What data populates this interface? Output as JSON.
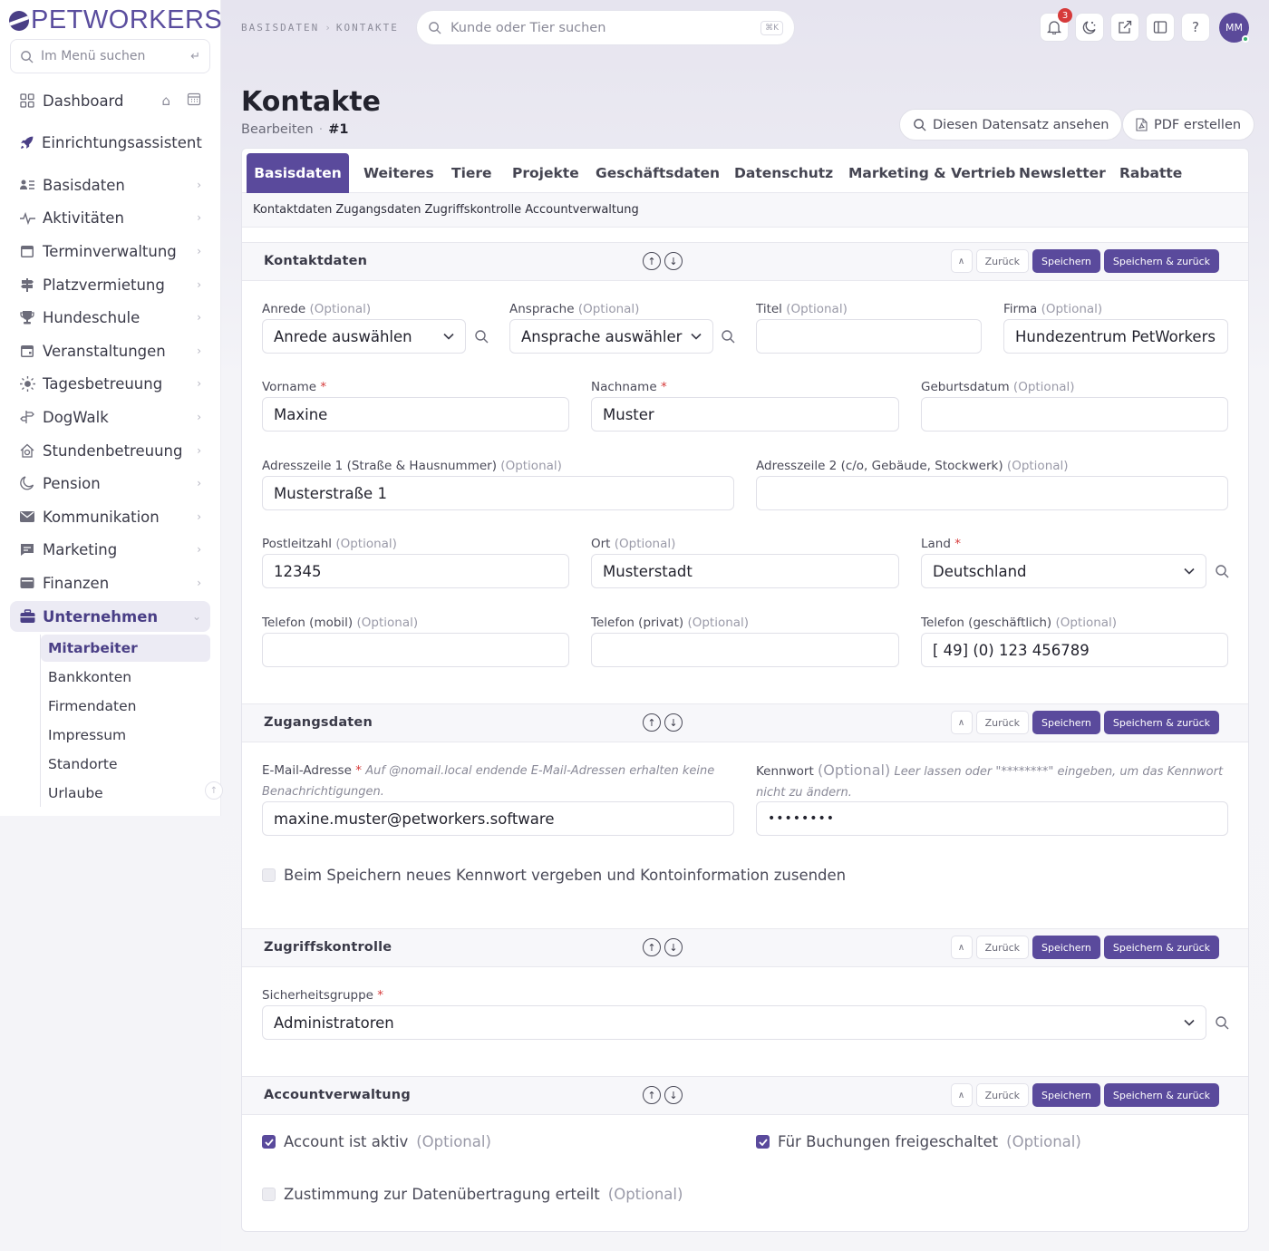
{
  "brand": {
    "name": "PETWORKERS"
  },
  "sidebar": {
    "search_placeholder": "Im Menü suchen",
    "items": [
      {
        "label": "Dashboard",
        "icon": "dashboard-grid-icon"
      },
      {
        "label": "Einrichtungsassistent",
        "icon": "rocket-icon"
      },
      {
        "label": "Basisdaten",
        "icon": "list-user-icon"
      },
      {
        "label": "Aktivitäten",
        "icon": "activity-icon"
      },
      {
        "label": "Terminverwaltung",
        "icon": "calendar-icon"
      },
      {
        "label": "Platzvermietung",
        "icon": "signpost-icon"
      },
      {
        "label": "Hundeschule",
        "icon": "trophy-icon"
      },
      {
        "label": "Veranstaltungen",
        "icon": "calendar-event-icon"
      },
      {
        "label": "Tagesbetreuung",
        "icon": "sun-icon"
      },
      {
        "label": "DogWalk",
        "icon": "signpost-split-icon"
      },
      {
        "label": "Stundenbetreuung",
        "icon": "house-clock-icon"
      },
      {
        "label": "Pension",
        "icon": "moon-icon"
      },
      {
        "label": "Kommunikation",
        "icon": "envelope-icon"
      },
      {
        "label": "Marketing",
        "icon": "chat-icon"
      },
      {
        "label": "Finanzen",
        "icon": "wallet-icon"
      },
      {
        "label": "Unternehmen",
        "icon": "briefcase-icon"
      }
    ],
    "sub_items": [
      "Mitarbeiter",
      "Bankkonten",
      "Firmendaten",
      "Impressum",
      "Standorte",
      "Urlaube"
    ]
  },
  "topbar": {
    "breadcrumb": [
      "BASISDATEN",
      "KONTAKTE"
    ],
    "search_placeholder": "Kunde oder Tier suchen",
    "search_shortcut": "⌘K",
    "notification_count": "3",
    "help": "?",
    "avatar_initials": "MM"
  },
  "page": {
    "title": "Kontakte",
    "mode": "Bearbeiten",
    "record": "#1",
    "view_button": "Diesen Datensatz ansehen",
    "pdf_button": "PDF erstellen"
  },
  "tabs": [
    "Basisdaten",
    "Weiteres",
    "Tiere",
    "Projekte",
    "Geschäftsdaten",
    "Datenschutz",
    "Marketing & Vertrieb",
    "Newsletter",
    "Rabatte"
  ],
  "subnav": [
    "Kontaktdaten",
    "Zugangsdaten",
    "Zugriffskontrolle",
    "Accountverwaltung"
  ],
  "actions": {
    "up": "∧",
    "back": "Zurück",
    "save": "Speichern",
    "save_back": "Speichern & zurück"
  },
  "labels": {
    "optional": "(Optional)",
    "required": "*"
  },
  "sections": {
    "kontaktdaten": {
      "title": "Kontaktdaten",
      "anrede": {
        "label": "Anrede",
        "value": "Anrede auswählen"
      },
      "ansprache": {
        "label": "Ansprache",
        "value": "Ansprache auswähler"
      },
      "titel": {
        "label": "Titel",
        "value": ""
      },
      "firma": {
        "label": "Firma",
        "value": "Hundezentrum PetWorkers"
      },
      "vorname": {
        "label": "Vorname",
        "value": "Maxine"
      },
      "nachname": {
        "label": "Nachname",
        "value": "Muster"
      },
      "geburtsdatum": {
        "label": "Geburtsdatum",
        "value": ""
      },
      "adresse1": {
        "label": "Adresszeile 1 (Straße & Hausnummer)",
        "value": "Musterstraße 1"
      },
      "adresse2": {
        "label": "Adresszeile 2 (c/o, Gebäude, Stockwerk)",
        "value": ""
      },
      "plz": {
        "label": "Postleitzahl",
        "value": "12345"
      },
      "ort": {
        "label": "Ort",
        "value": "Musterstadt"
      },
      "land": {
        "label": "Land",
        "value": "Deutschland"
      },
      "tel_mobil": {
        "label": "Telefon (mobil)",
        "value": ""
      },
      "tel_privat": {
        "label": "Telefon (privat)",
        "value": ""
      },
      "tel_geschaeftlich": {
        "label": "Telefon (geschäftlich)",
        "value": "[ 49] (0) 123 456789"
      }
    },
    "zugangsdaten": {
      "title": "Zugangsdaten",
      "email": {
        "label": "E-Mail-Adresse",
        "hint": "Auf @nomail.local endende E-Mail-Adressen erhalten keine Benachrichtigungen.",
        "value": "maxine.muster@petworkers.software"
      },
      "kennwort": {
        "label": "Kennwort",
        "hint": "Leer lassen oder \"********\" eingeben, um das Kennwort nicht zu ändern.",
        "value": "••••••••"
      },
      "send_checkbox": "Beim Speichern neues Kennwort vergeben und Kontoinformation zusenden"
    },
    "zugriffskontrolle": {
      "title": "Zugriffskontrolle",
      "gruppe": {
        "label": "Sicherheitsgruppe",
        "value": "Administratoren"
      }
    },
    "accountverwaltung": {
      "title": "Accountverwaltung",
      "aktiv": "Account ist aktiv",
      "buchungen": "Für Buchungen freigeschaltet",
      "zustimmung": "Zustimmung zur Datenübertragung erteilt"
    }
  }
}
